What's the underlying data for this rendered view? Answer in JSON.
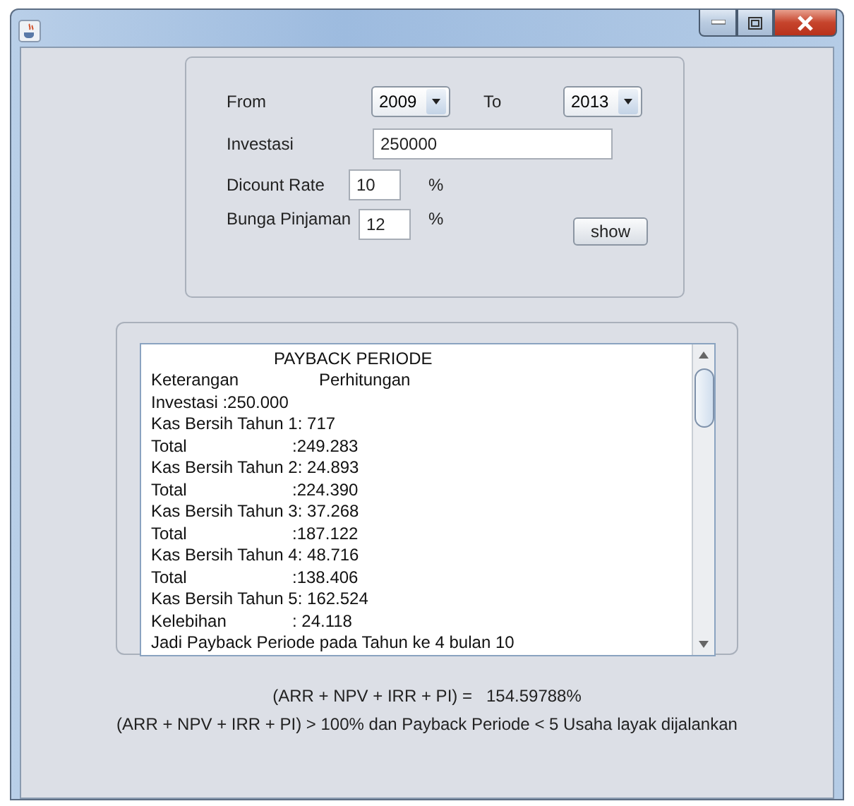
{
  "form": {
    "from": {
      "label": "From",
      "value": "2009"
    },
    "to": {
      "label": "To",
      "value": "2013"
    },
    "investasi": {
      "label": "Investasi",
      "value": "250000"
    },
    "discount": {
      "label": "Dicount Rate",
      "value": "10",
      "unit": "%"
    },
    "bunga": {
      "label": "Bunga Pinjaman",
      "value": "12",
      "unit": "%"
    },
    "button": "show"
  },
  "report": {
    "lines": [
      {
        "kind": "title",
        "text": "PAYBACK PERIODE"
      },
      {
        "kind": "heading",
        "text": "Keterangan",
        "value": "Perhitungan"
      },
      {
        "kind": "text",
        "text": "Investasi :250.000"
      },
      {
        "kind": "text",
        "text": "Kas Bersih Tahun 1: 717"
      },
      {
        "kind": "pair",
        "text": "Total",
        "value": ":249.283"
      },
      {
        "kind": "text",
        "text": "Kas Bersih Tahun 2: 24.893"
      },
      {
        "kind": "pair",
        "text": "Total",
        "value": ":224.390"
      },
      {
        "kind": "text",
        "text": "Kas Bersih Tahun 3: 37.268"
      },
      {
        "kind": "pair",
        "text": "Total",
        "value": ":187.122"
      },
      {
        "kind": "text",
        "text": "Kas Bersih Tahun 4: 48.716"
      },
      {
        "kind": "pair",
        "text": "Total",
        "value": ":138.406"
      },
      {
        "kind": "text",
        "text": "Kas Bersih Tahun 5: 162.524"
      },
      {
        "kind": "pair",
        "text": "Kelebihan",
        "value": ": 24.118"
      },
      {
        "kind": "text",
        "text": "Jadi Payback Periode pada Tahun ke 4 bulan 10"
      }
    ]
  },
  "result": {
    "formula": "(ARR + NPV + IRR + PI) =",
    "value": "154.59788%",
    "conclusion": "(ARR + NPV + IRR + PI) > 100% dan Payback Periode < 5 Usaha layak dijalankan"
  }
}
